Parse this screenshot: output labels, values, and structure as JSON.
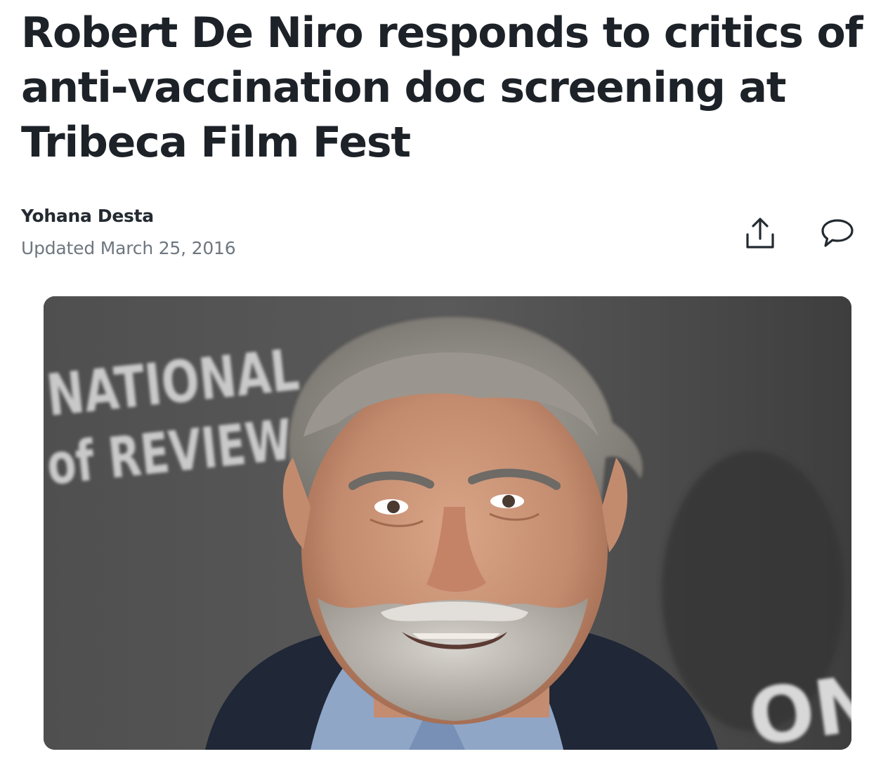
{
  "article": {
    "headline": "Robert De Niro responds to critics of anti-vaccination doc screening at Tribeca Film Fest",
    "author": "Yohana Desta",
    "updated": "Updated March 25, 2016"
  },
  "actions": {
    "share_icon": "share-icon",
    "comment_icon": "comment-icon"
  },
  "hero_image": {
    "backdrop_text_line1": "NATIONAL",
    "backdrop_text_line2": "of REVIEW",
    "backdrop_text_corner": "ON"
  },
  "colors": {
    "headline": "#1d2228",
    "meta": "#6e7780",
    "icon": "#232a31"
  }
}
